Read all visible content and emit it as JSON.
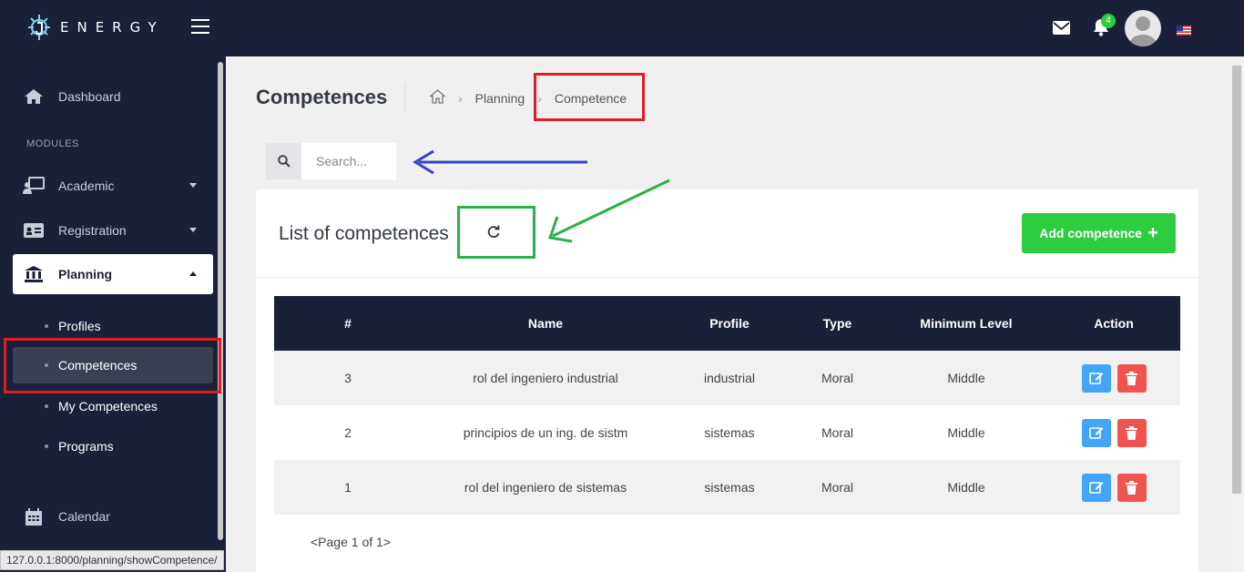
{
  "header": {
    "logo_text": "ENERGY",
    "notification_count": "4",
    "icons": [
      "mail-icon",
      "bell-icon",
      "avatar",
      "us-flag-icon",
      "hamburger-icon"
    ]
  },
  "sidebar": {
    "dashboard": "Dashboard",
    "section": "MODULES",
    "academic": "Academic",
    "registration": "Registration",
    "planning": "Planning",
    "sub": {
      "profiles": "Profiles",
      "competences": "Competences",
      "my_competences": "My Competences",
      "programs": "Programs"
    },
    "calendar": "Calendar"
  },
  "status_url": "127.0.0.1:8000/planning/showCompetence/",
  "page": {
    "title": "Competences",
    "breadcrumb": {
      "planning": "Planning",
      "current": "Competence"
    },
    "search_placeholder": "Search..."
  },
  "card": {
    "title": "List of competences",
    "add_label": "Add competence"
  },
  "table": {
    "headers": {
      "num": "#",
      "name": "Name",
      "profile": "Profile",
      "type": "Type",
      "level": "Minimum Level",
      "action": "Action"
    },
    "rows": [
      {
        "num": "3",
        "name": "rol del ingeniero industrial",
        "profile": "industrial",
        "type": "Moral",
        "level": "Middle"
      },
      {
        "num": "2",
        "name": "principios de un ing. de sistm",
        "profile": "sistemas",
        "type": "Moral",
        "level": "Middle"
      },
      {
        "num": "1",
        "name": "rol del ingeniero de sistemas",
        "profile": "sistemas",
        "type": "Moral",
        "level": "Middle"
      }
    ]
  },
  "pagination": "<Page 1 of 1>",
  "colors": {
    "navy": "#1b2039",
    "green": "#2ecc40",
    "edit_blue": "#42a5f5",
    "delete_red": "#ef5350",
    "highlight_red": "#e01b24",
    "highlight_green": "#28b24b",
    "arrow_blue": "#3344cc"
  }
}
